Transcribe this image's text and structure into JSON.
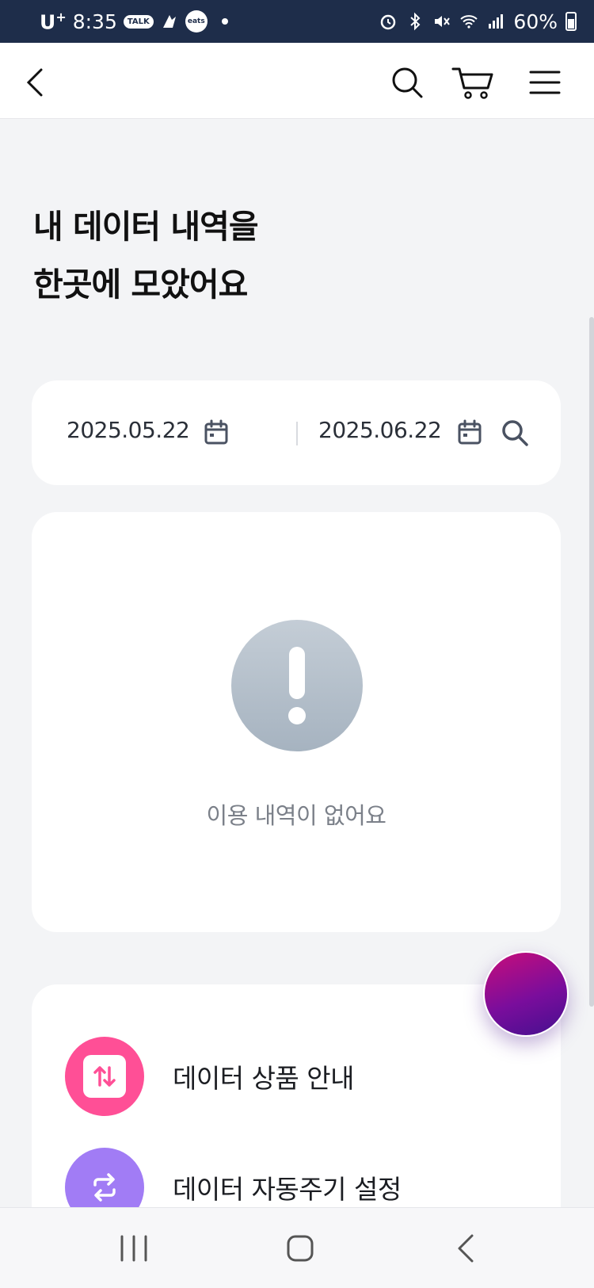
{
  "status_bar": {
    "carrier": "U",
    "carrier_sup": "+",
    "time": "8:35",
    "talk_badge": "TALK",
    "eats_badge": "eats",
    "battery": "60%"
  },
  "header": {
    "back_icon": "chevron-left-icon",
    "search_icon": "search-icon",
    "cart_icon": "cart-icon",
    "menu_icon": "hamburger-menu-icon"
  },
  "page": {
    "title_line1": "내 데이터 내역을",
    "title_line2": "한곳에 모았어요"
  },
  "date_filter": {
    "start_date": "2025.05.22",
    "end_date": "2025.06.22",
    "calendar_icon": "calendar-icon",
    "search_icon": "search-icon"
  },
  "empty_state": {
    "icon": "exclamation-icon",
    "message": "이용 내역이 없어요"
  },
  "menu": {
    "items": [
      {
        "label": "데이터 상품 안내",
        "icon": "up-down-arrows-icon",
        "color": "#ff4f96"
      },
      {
        "label": "데이터 자동주기 설정",
        "icon": "repeat-icon",
        "color": "#a17cf5"
      }
    ]
  },
  "colors": {
    "status_bar_bg": "#1e2d4a",
    "page_bg": "#f3f4f6",
    "fab_gradient_start": "#c80d7a",
    "fab_gradient_end": "#45108f"
  }
}
